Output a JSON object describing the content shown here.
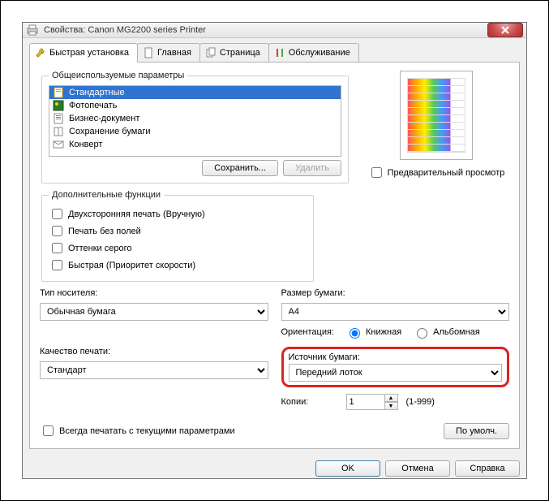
{
  "window": {
    "title": "Свойства: Canon MG2200 series Printer"
  },
  "tabs": {
    "quick": "Быстрая установка",
    "main": "Главная",
    "page": "Страница",
    "maint": "Обслуживание"
  },
  "profiles": {
    "legend": "Общеиспользуемые параметры",
    "items": [
      {
        "label": "Стандартные"
      },
      {
        "label": "Фотопечать"
      },
      {
        "label": "Бизнес-документ"
      },
      {
        "label": "Сохранение бумаги"
      },
      {
        "label": "Конверт"
      }
    ],
    "save": "Сохранить...",
    "delete": "Удалить"
  },
  "preview": {
    "checkbox": "Предварительный просмотр"
  },
  "extras": {
    "legend": "Дополнительные функции",
    "duplex": "Двухсторонняя печать (Вручную)",
    "borderless": "Печать без полей",
    "gray": "Оттенки серого",
    "fast": "Быстрая (Приоритет скорости)"
  },
  "media": {
    "label": "Тип носителя:",
    "value": "Обычная бумага"
  },
  "quality": {
    "label": "Качество печати:",
    "value": "Стандарт"
  },
  "size": {
    "label": "Размер бумаги:",
    "value": "A4"
  },
  "orient": {
    "label": "Ориентация:",
    "portrait": "Книжная",
    "landscape": "Альбомная"
  },
  "source": {
    "label": "Источник бумаги:",
    "value": "Передний лоток"
  },
  "copies": {
    "label": "Копии:",
    "value": "1",
    "range": "(1-999)"
  },
  "always": {
    "label": "Всегда печатать с текущими параметрами"
  },
  "defaults": {
    "label": "По умолч."
  },
  "buttons": {
    "ok": "OK",
    "cancel": "Отмена",
    "help": "Справка"
  }
}
